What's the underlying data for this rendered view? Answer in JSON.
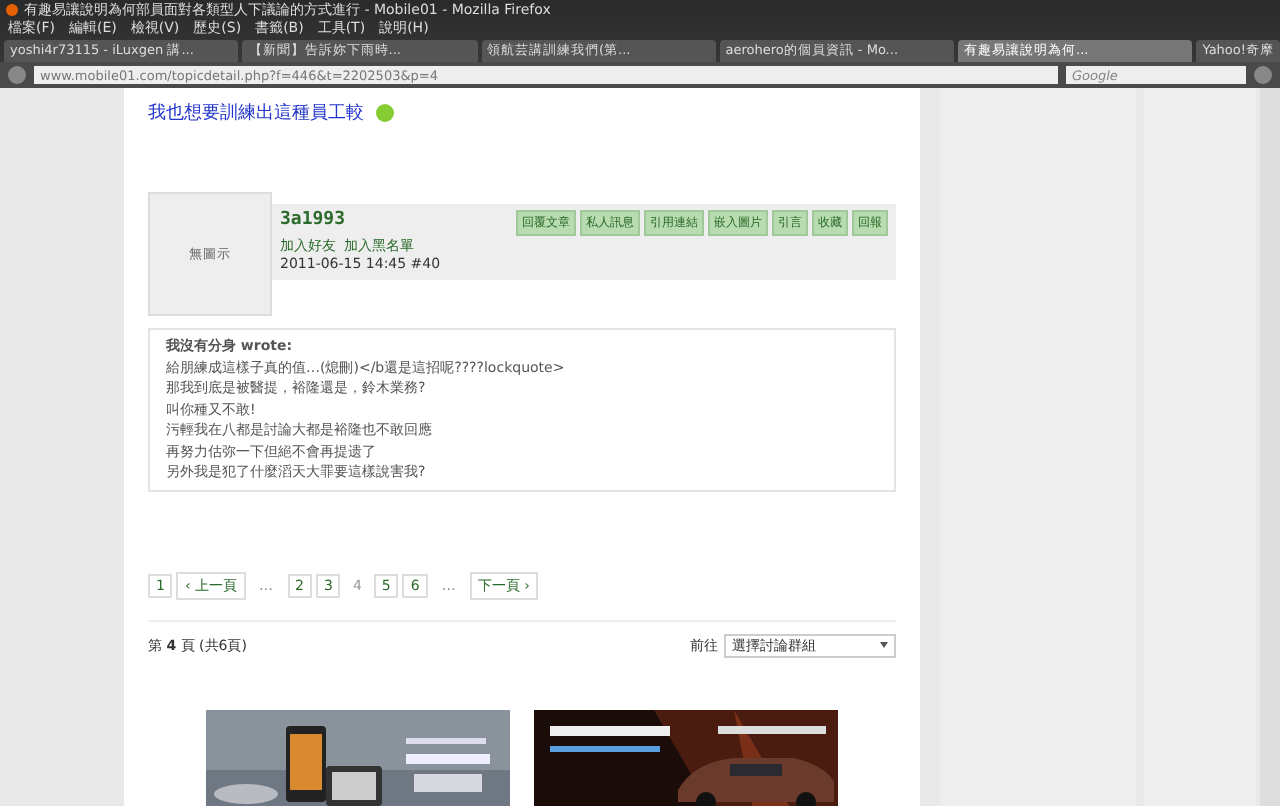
{
  "window": {
    "title": "有趣易讓說明為何部員面對各類型人下議論的方式進行 - Mobile01 - Mozilla Firefox"
  },
  "menu": [
    "檔案(F)",
    "編輯(E)",
    "檢視(V)",
    "歷史(S)",
    "書籤(B)",
    "工具(T)",
    "說明(H)"
  ],
  "tabs": [
    {
      "label": "yoshi4r73115 - iLuxgen 講...",
      "selected": false
    },
    {
      "label": "【新聞】告訴妳下雨時...",
      "selected": false
    },
    {
      "label": "領航芸講訓練我們(第...",
      "selected": false
    },
    {
      "label": "aerohero的個員資訊 - Mo...",
      "selected": false
    },
    {
      "label": "有趣易讓說明為何...",
      "selected": true
    },
    {
      "label": "Yahoo!奇摩",
      "selected": false
    }
  ],
  "address": "www.mobile01.com/topicdetail.php?f=446&t=2202503&p=4",
  "search": {
    "placeholder": "Google"
  },
  "post": {
    "title": "我也想要訓練出這種員工較",
    "avatar": "無圖示",
    "username": "3a1993",
    "links": [
      "加入好友",
      "加入黑名單"
    ],
    "meta": "2011-06-15 14:45  #40",
    "actions": [
      "回覆文章",
      "私人訊息",
      "引用連結",
      "嵌入圖片",
      "引言",
      "收藏",
      "回報"
    ],
    "quote": {
      "author": "我沒有分身 wrote:",
      "lines": [
        "給朋練成這樣子真的值…(熄刪)</b還是這招呢????lockquote>",
        "那我到底是被醫提，裕隆還是，鈴木業務?",
        "叫你種又不敢!",
        "污輕我在八都是討論大都是裕隆也不敢回應",
        "再努力估弥一下但絕不會再提遗了",
        "另外我是犯了什麼滔天大罪要這樣說害我?"
      ]
    }
  },
  "pager": [
    {
      "label": "1",
      "kind": "page",
      "selected": false
    },
    {
      "label": "‹ 上一頁",
      "kind": "page",
      "selected": false
    },
    {
      "label": "…",
      "kind": "gap"
    },
    {
      "label": "2",
      "kind": "page",
      "selected": false
    },
    {
      "label": "3",
      "kind": "page",
      "selected": false
    },
    {
      "label": "4",
      "kind": "page",
      "selected": true
    },
    {
      "label": "5",
      "kind": "page",
      "selected": false
    },
    {
      "label": "6",
      "kind": "page",
      "selected": false
    },
    {
      "label": "…",
      "kind": "gap"
    },
    {
      "label": "下一頁 ›",
      "kind": "page",
      "selected": false
    }
  ],
  "page_info": "第 **4** 頁 (共6頁)",
  "goto": {
    "label": "前往",
    "value": "選擇討論群組"
  }
}
